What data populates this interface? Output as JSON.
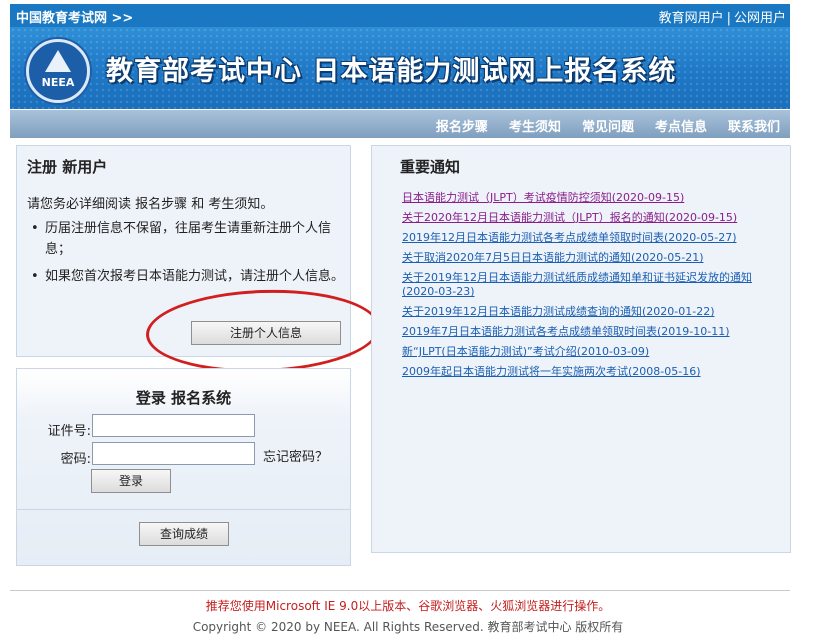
{
  "topbar": {
    "site_link": "中国教育考试网 >>",
    "edu_user": "教育网用户",
    "separator": "|",
    "public_user": "公网用户"
  },
  "banner": {
    "logo_text": "NEEA",
    "title": "教育部考试中心  日本语能力测试网上报名系统"
  },
  "nav": {
    "items": [
      "报名步骤",
      "考生须知",
      "常见问题",
      "考点信息",
      "联系我们"
    ]
  },
  "register": {
    "heading": "注册 新用户",
    "intro": "请您务必详细阅读 报名步骤 和 考生须知。",
    "bullets": [
      "历届注册信息不保留，往届考生请重新注册个人信息；",
      "如果您首次报考日本语能力测试，请注册个人信息。"
    ],
    "button": "注册个人信息",
    "highlight_color": "#d11f1f"
  },
  "login": {
    "heading": "登录 报名系统",
    "id_label": "证件号:",
    "password_label": "密码:",
    "id_value": "",
    "password_value": "",
    "forgot": "忘记密码？",
    "login_button": "登录",
    "score_button": "查询成绩"
  },
  "notices": {
    "heading": "重要通知",
    "items": [
      "日本语能力测试（JLPT）考试疫情防控须知(2020-09-15)",
      "关于2020年12月日本语能力测试（JLPT）报名的通知(2020-09-15)",
      "2019年12月日本语能力测试各考点成绩单领取时间表(2020-05-27)",
      "关于取消2020年7月5日日本语能力测试的通知(2020-05-21)",
      "关于2019年12月日本语能力测试纸质成绩通知单和证书延迟发放的通知(2020-03-23)",
      "关于2019年12月日本语能力测试成绩查询的通知(2020-01-22)",
      "2019年7月日本语能力测试各考点成绩单领取时间表(2019-10-11)",
      "新“JLPT(日本语能力测试)”考试介绍(2010-03-09)",
      "2009年起日本语能力测试将一年实施两次考试(2008-05-16)"
    ],
    "link_color": "#1a5fb4",
    "visited_color": "#8a1d8a"
  },
  "footer": {
    "recommend": "推荐您使用Microsoft IE 9.0以上版本、谷歌浏览器、火狐浏览器进行操作。",
    "copyright": "Copyright © 2020 by NEEA. All Rights Reserved. 教育部考试中心 版权所有"
  }
}
